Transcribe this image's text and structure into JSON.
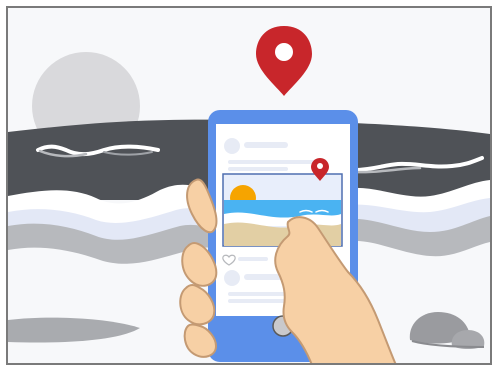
{
  "scene": {
    "type": "illustration",
    "colors": {
      "frame": "#7a7a7a",
      "sky": "#f7f8fa",
      "sun_gray": "#d9d9dc",
      "sea_dark": "#4f5257",
      "sea_mid": "#b7b9bd",
      "foam_white": "#ffffff",
      "foam_blue": "#e3e8f6",
      "phone_blue": "#5b8fe9",
      "phone_screen": "#ffffff",
      "card_lines": "#e7ebf5",
      "pin_red": "#c8262b",
      "hand_skin": "#f7d0a5",
      "hand_outline": "#c49a73",
      "photo_sky": "#e8eefb",
      "photo_sun": "#f6a400",
      "photo_sea": "#4ab3f2",
      "photo_sand": "#e2cfa4",
      "rock": "#9a9b9f"
    },
    "icons": {
      "location_pin": "map-pin-icon",
      "photo_pin": "map-pin-icon",
      "heart": "heart-outline-icon",
      "home_button": "circle-home-button"
    }
  }
}
